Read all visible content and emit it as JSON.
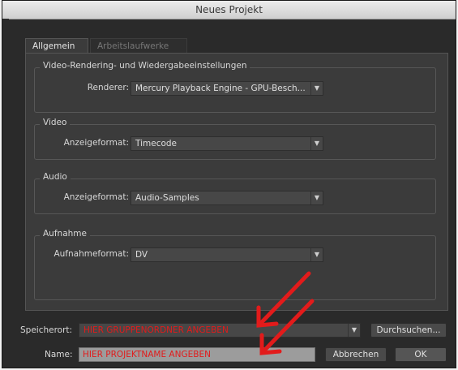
{
  "window": {
    "title": "Neues Projekt"
  },
  "tabs": [
    {
      "label": "Allgemein"
    },
    {
      "label": "Arbeitslaufwerke"
    }
  ],
  "groups": {
    "rendering": {
      "title": "Video-Rendering- und Wiedergabeeinstellungen",
      "label": "Renderer:",
      "value": "Mercury Playback Engine - GPU-Besch..."
    },
    "video": {
      "title": "Video",
      "label": "Anzeigeformat:",
      "value": "Timecode"
    },
    "audio": {
      "title": "Audio",
      "label": "Anzeigeformat:",
      "value": "Audio-Samples"
    },
    "capture": {
      "title": "Aufnahme",
      "label": "Aufnahmeformat:",
      "value": "DV"
    }
  },
  "bottom": {
    "location_label": "Speicherort:",
    "location_value": "HIER GRUPPENORDNER ANGEBEN",
    "browse_label": "Durchsuchen...",
    "name_label": "Name:",
    "name_value": "HIER PROJEKTNAME ANGEBEN",
    "cancel_label": "Abbrechen",
    "ok_label": "OK"
  },
  "colors": {
    "annotation_red": "#e21b1b",
    "panel": "#3b3b3b",
    "window": "#2a2a2a"
  }
}
